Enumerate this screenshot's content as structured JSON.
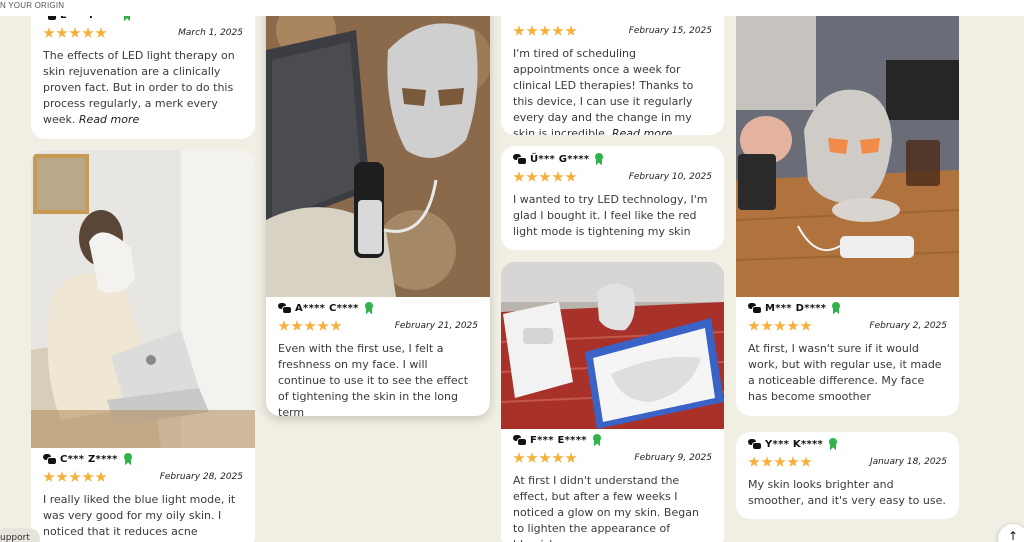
{
  "header": {
    "tagline": "N YOUR ORIGIN"
  },
  "reviews": [
    {
      "name": "E*** T****",
      "date": "March 1, 2025",
      "text": "The effects of LED light therapy on skin rejuvenation are a clinically proven fact. But in order to do this process regularly, a merk every week.",
      "read_more": "Read more"
    },
    {
      "name": "C*** Z****",
      "date": "February 28, 2025",
      "text": "I really liked the blue light mode, it was very good for my oily skin. I noticed that it reduces acne formation"
    },
    {
      "name": "A**** C****",
      "date": "February 21, 2025",
      "text": "Even with the first use, I felt a freshness on my face. I will continue to use it to see the effect of tightening the skin in the long term"
    },
    {
      "name": "",
      "date": "February 15, 2025",
      "text": "I'm tired of scheduling appointments once a week for clinical LED therapies! Thanks to this device, I can use it regularly every day and the change in my skin is incredible.",
      "read_more": "Read more"
    },
    {
      "name": "Ü*** G****",
      "date": "February 10, 2025",
      "text": "I wanted to try LED technology, I'm glad I bought it. I feel like the red light mode is tightening my skin"
    },
    {
      "name": "F*** E****",
      "date": "February 9, 2025",
      "text": "At first I didn't understand the effect, but after a few weeks I noticed a glow on my skin. Began to lighten the appearance of blemishes"
    },
    {
      "name": "M*** D****",
      "date": "February 2, 2025",
      "text": "At first, I wasn't sure if it would work, but with regular use, it made a noticeable difference. My face has become smoother"
    },
    {
      "name": "Y*** K****",
      "date": "January 18, 2025",
      "text": "My skin looks brighter and smoother, and it's very easy to use."
    }
  ],
  "rating_stars": 5,
  "colors": {
    "page_bg": "#f1efe3",
    "star": "#f4b13a",
    "verified": "#2fb34a"
  },
  "support": {
    "label": "upport"
  },
  "scroll_top": {
    "icon": "arrow-up-icon",
    "glyph": "↑"
  }
}
